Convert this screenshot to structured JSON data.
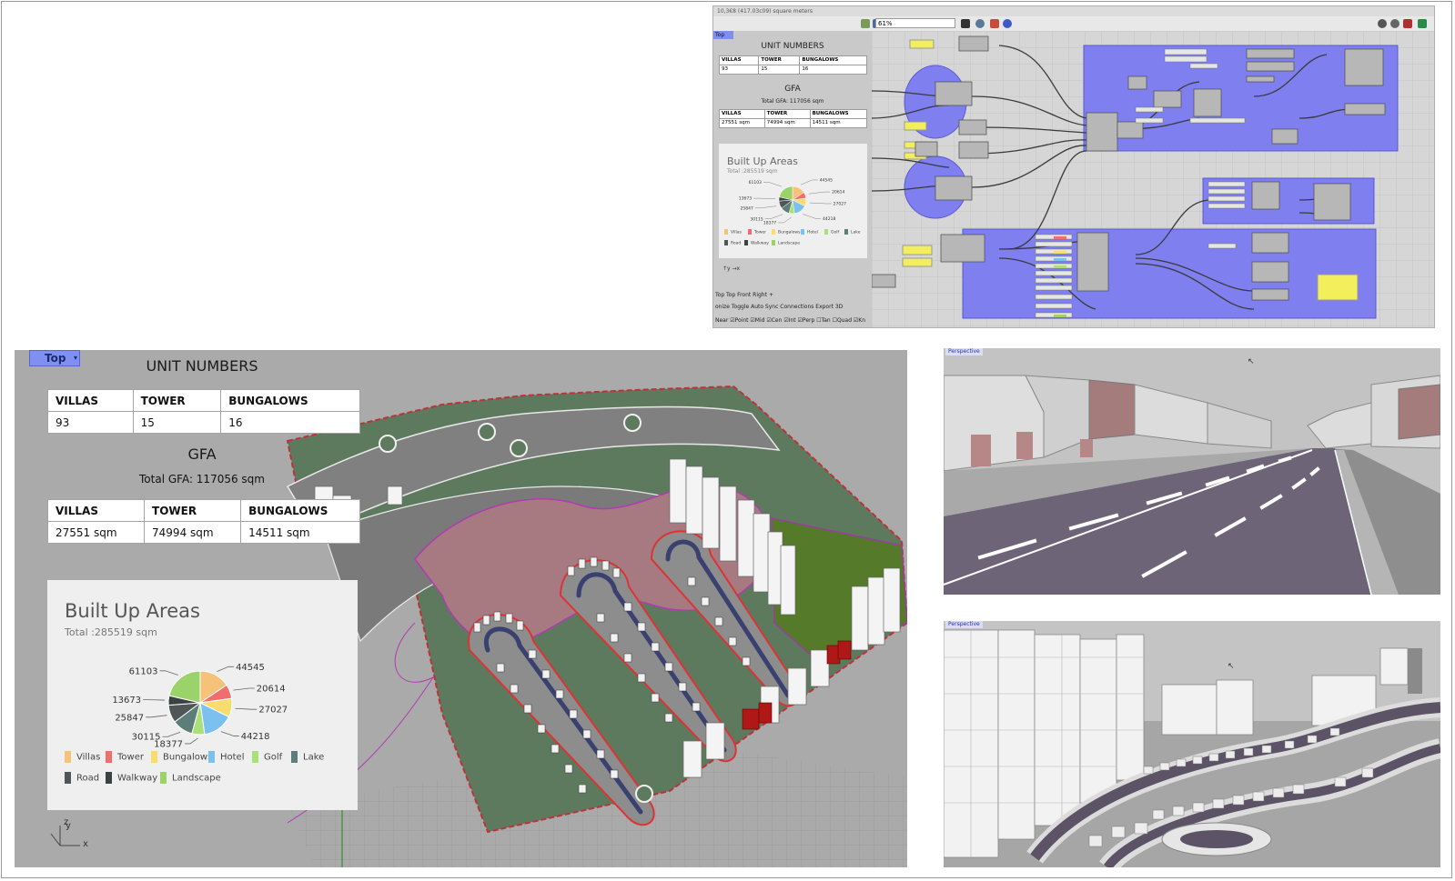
{
  "grasshopper": {
    "title_partial": "10,3€8 (417.03c09) square meters",
    "zoom": "61%",
    "view_tab": "Top",
    "unit_numbers_title": "UNIT NUMBERS",
    "units_headers": [
      "VILLAS",
      "TOWER",
      "BUNGALOWS"
    ],
    "units_values": [
      "93",
      "15",
      "16"
    ],
    "gfa_title": "GFA",
    "gfa_total": "Total GFA: 117056 sqm",
    "gfa_headers": [
      "VILLAS",
      "TOWER",
      "BUNGALOWS"
    ],
    "gfa_values": [
      "27551 sqm",
      "74994 sqm",
      "14511 sqm"
    ],
    "chart_title": "Built Up Areas",
    "chart_total": "Total :285519 sqm",
    "view_tabs_line": "Top   Top   Front   Right  +",
    "toolbar_line": "onize   Toggle Auto Sync     Connections     Export 3D",
    "snap_line": "Near ☑Point ☑Mid ☑Cen ☑Int ☑Perp ☐Tan ☐Quad ☑Kn"
  },
  "top_viewport": {
    "tab_label": "Top",
    "unit_numbers_title": "UNIT NUMBERS",
    "units_headers": [
      "VILLAS",
      "TOWER",
      "BUNGALOWS"
    ],
    "units_values": [
      "93",
      "15",
      "16"
    ],
    "gfa_title": "GFA",
    "gfa_total": "Total GFA: 117056 sqm",
    "gfa_headers": [
      "VILLAS",
      "TOWER",
      "BUNGALOWS"
    ],
    "gfa_values": [
      "27551 sqm",
      "74994 sqm",
      "14511 sqm"
    ],
    "axis_y": "y",
    "axis_z": "z",
    "axis_x": "x"
  },
  "perspective_views": {
    "top_label": "Perspective",
    "bottom_label": "Perspective"
  },
  "chart_data": {
    "type": "pie",
    "title": "Built Up Areas",
    "subtitle": "Total :285519 sqm",
    "categories": [
      "Villas",
      "Tower",
      "Bungalows",
      "Hotel",
      "Golf",
      "Lake",
      "Road",
      "Walkway",
      "Landscape"
    ],
    "values": [
      44545,
      20614,
      27027,
      44218,
      18377,
      30115,
      25847,
      13673,
      61103
    ],
    "slice_order": [
      "Villas",
      "Tower",
      "Bungalows",
      "Hotel",
      "Golf",
      "Lake",
      "Road",
      "Walkway",
      "Landscape"
    ],
    "colors": [
      "#f6c27a",
      "#f06e6e",
      "#f8dc6e",
      "#7cc0ef",
      "#a9e07a",
      "#5d7d78",
      "#4f5657",
      "#3c4142",
      "#9ad36a"
    ],
    "legend_placement": "bottom-left"
  }
}
